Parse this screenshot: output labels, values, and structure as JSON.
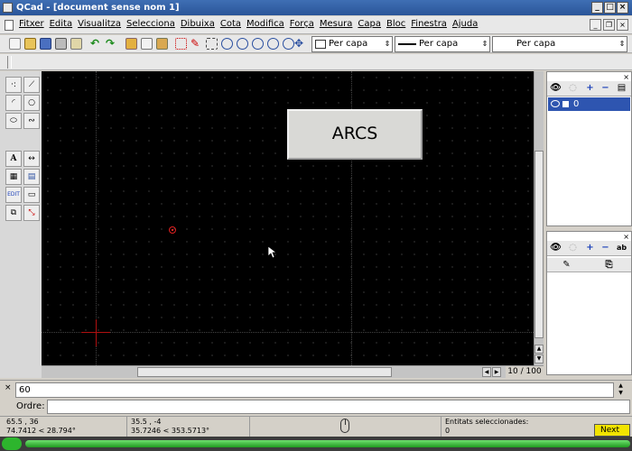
{
  "window": {
    "title": "QCad - [document sense nom 1]"
  },
  "menu": [
    "Fitxer",
    "Edita",
    "Visualitza",
    "Selecciona",
    "Dibuixa",
    "Cota",
    "Modifica",
    "Força",
    "Mesura",
    "Capa",
    "Bloc",
    "Finestra",
    "Ajuda"
  ],
  "toolbar": {
    "color_combo": "Per capa",
    "width_combo": "Per capa",
    "linetype_combo": "Per capa"
  },
  "canvas": {
    "label_box": "ARCS",
    "page_count": "10 / 100"
  },
  "layers": {
    "items": [
      {
        "name": "0"
      }
    ]
  },
  "command": {
    "history": "60",
    "prompt_label": "Ordre:",
    "input_value": ""
  },
  "status": {
    "abs_coord": "65.5 , 36",
    "abs_polar": "74.7412 < 28.794°",
    "rel_coord": "35.5 , -4",
    "rel_polar": "35.7246 < 353.5713°",
    "selected_label": "Entitats seleccionades:",
    "selected_count": "0"
  },
  "next_button": "Next",
  "colors": {
    "canvas_bg": "#000000",
    "titlebar": "#3f6fb4",
    "selection": "#2e55b0",
    "accent_red": "#e02020",
    "next_yellow": "#f2e400"
  }
}
